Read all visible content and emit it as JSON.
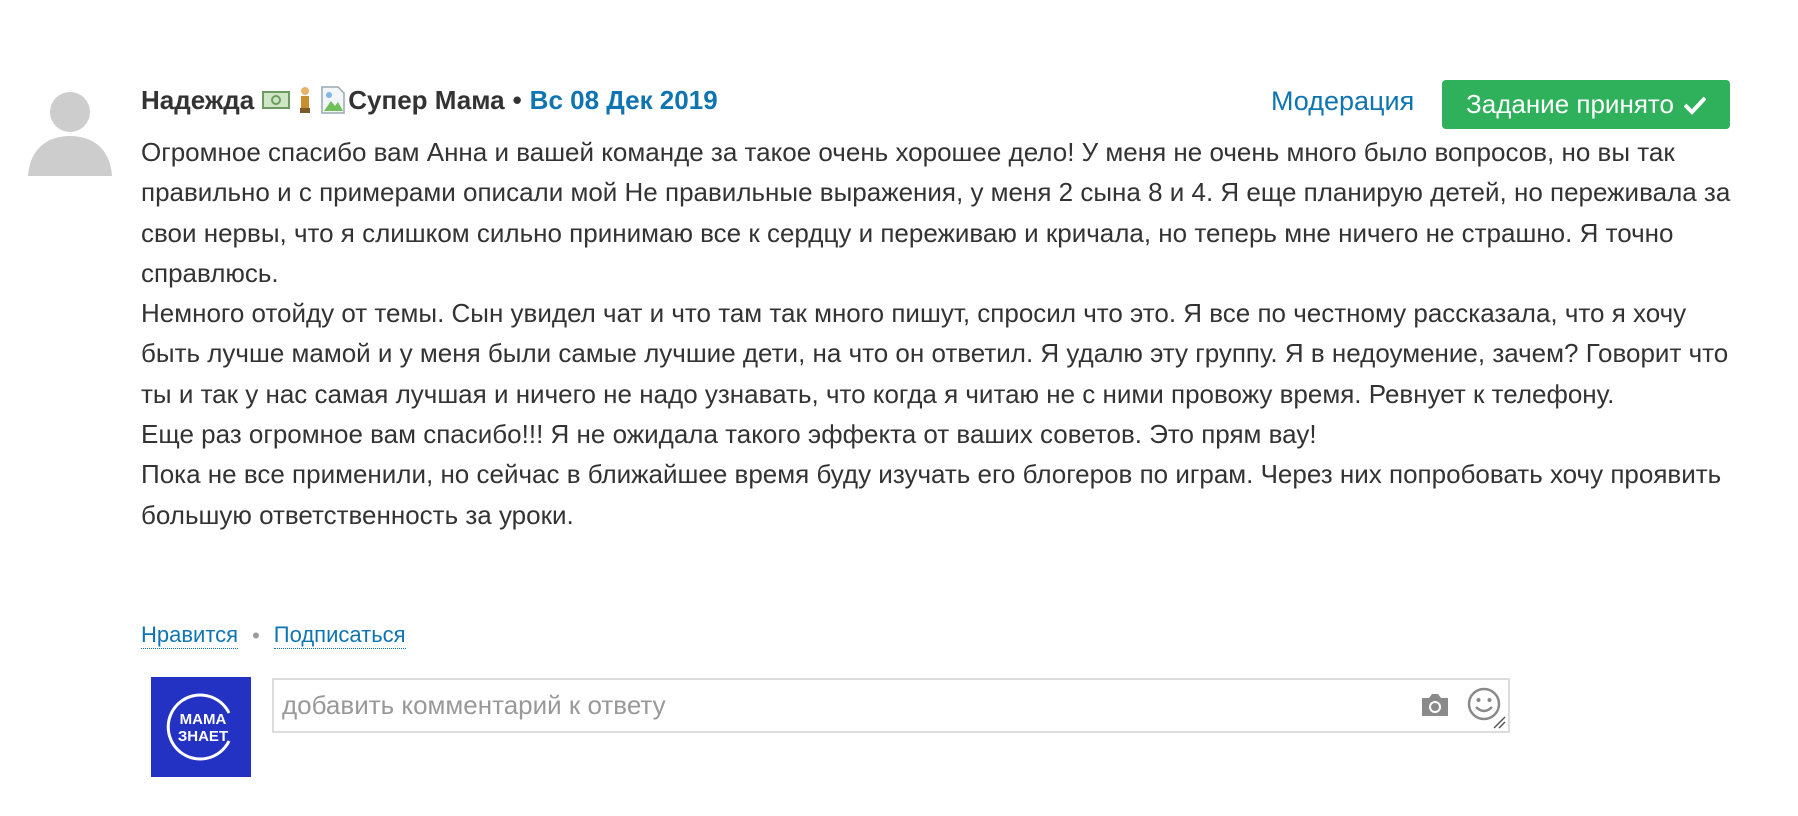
{
  "comment": {
    "author": "Надежда",
    "status_title": "Супер Мама",
    "separator": "•",
    "date": "Вс 08 Дек 2019",
    "moderation_label": "Модерация",
    "accepted_label": "Задание принято",
    "paragraphs": [
      "Огромное спасибо вам Анна и вашей команде за такое очень хорошее дело! У меня не очень много было вопросов, но вы так правильно и с примерами описали мой Не правильные выражения, у меня 2 сына 8 и 4. Я еще планирую детей, но переживала за свои нервы, что я слишком сильно принимаю все к сердцу и переживаю и кричала, но теперь мне ничего не страшно. Я точно справлюсь.",
      "Немного отойду от темы. Сын увидел чат и что там так много пишут, спросил что это. Я все по честному рассказала, что я хочу быть лучше мамой и у меня были самые лучшие дети, на что он ответил. Я удалю эту группу. Я в недоумение, зачем? Говорит что ты и так у нас самая лучшая и ничего не надо узнавать, что когда я читаю не с ними провожу время. Ревнует к телефону.",
      "Еще раз огромное вам спасибо!!! Я не ожидала такого эффекта от ваших советов. Это прям вау!",
      "Пока не все применили, но сейчас в ближайшее время буду изучать его блогеров по играм. Через них попробовать хочу проявить большую ответственность за уроки."
    ],
    "like_label": "Нравится",
    "action_separator": "•",
    "subscribe_label": "Подписаться"
  },
  "reply": {
    "placeholder": "добавить комментарий к ответу",
    "logo_text_top": "МАМА",
    "logo_text_bottom": "ЗНАЕТ"
  },
  "icons": {
    "avatar": "user-silhouette-icon",
    "money_badge": "money-icon",
    "status_badge": "figure-badge-icon",
    "broken_image": "broken-image-icon",
    "check": "check-icon",
    "camera": "camera-icon",
    "smiley": "smiley-icon",
    "resize": "resize-handle-icon"
  },
  "colors": {
    "link": "#0f74b2",
    "accepted_bg": "#2fb05a",
    "logo_bg": "#2332c3",
    "text": "#333333",
    "avatar_gray": "#cdcdcd"
  }
}
